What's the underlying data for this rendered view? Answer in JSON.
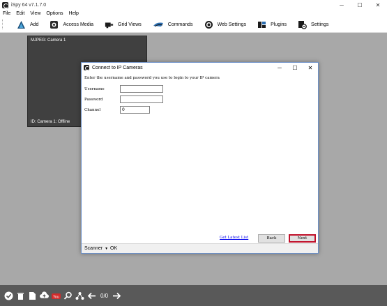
{
  "window": {
    "title": "iSpy 64 v7.1.7.0"
  },
  "menu": {
    "items": [
      "File",
      "Edit",
      "View",
      "Options",
      "Help"
    ]
  },
  "toolbar": {
    "items": [
      {
        "label": "Add",
        "icon": "add-icon"
      },
      {
        "label": "Access Media",
        "icon": "media-icon"
      },
      {
        "label": "Grid Views",
        "icon": "grid-icon"
      },
      {
        "label": "Commands",
        "icon": "commands-icon"
      },
      {
        "label": "Web Settings",
        "icon": "web-icon"
      },
      {
        "label": "Plugins",
        "icon": "plugins-icon"
      },
      {
        "label": "Settings",
        "icon": "settings-icon"
      }
    ]
  },
  "camera": {
    "name": "MJPEG: Camera 1",
    "status": "ID: Camera 1: Offline"
  },
  "bottombar": {
    "counter": "0/0"
  },
  "dialog": {
    "title": "Connect to IP Cameras",
    "instruction": "Enter the username and password you use to login to your IP camera",
    "fields": {
      "username": {
        "label": "Username",
        "value": ""
      },
      "password": {
        "label": "Password",
        "value": ""
      },
      "channel": {
        "label": "Channel",
        "value": "0"
      }
    },
    "latest_link": "Get Latest List",
    "back_label": "Back",
    "next_label": "Next",
    "status": {
      "scanner": "Scanner",
      "state": "OK"
    }
  },
  "colors": {
    "next_border": "#c0102a",
    "workspace": "#a8a8a8",
    "bottombar": "#595959"
  }
}
